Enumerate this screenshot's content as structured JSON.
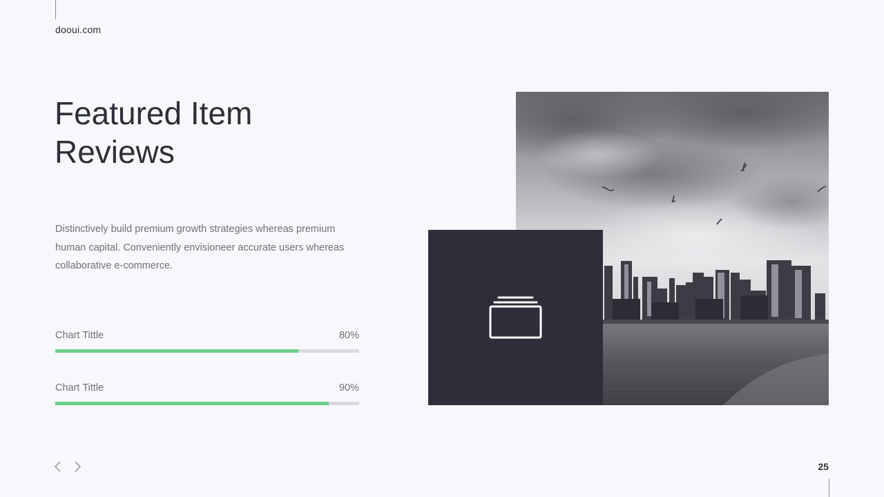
{
  "header": {
    "brand": "dooui.com"
  },
  "main": {
    "title_line1": "Featured Item",
    "title_line2": "Reviews",
    "body": "Distinctively build premium growth strategies whereas premium human capital. Conveniently envisioneer accurate users whereas collaborative e-commerce.",
    "progress": [
      {
        "label": "Chart Tittle",
        "value_text": "80%",
        "value": 0.8
      },
      {
        "label": "Chart Tittle",
        "value_text": "90%",
        "value": 0.9
      }
    ]
  },
  "media": {
    "icon": "stacked-window-icon",
    "photo": "city-skyline-photo"
  },
  "footer": {
    "page_number": "25",
    "prev_icon": "chevron-left-icon",
    "next_icon": "chevron-right-icon"
  },
  "colors": {
    "background": "#f7f8fc",
    "text_dark": "#2e2f3a",
    "text_muted": "#6f7079",
    "accent_green": "#6ccf88",
    "track_gray": "#d9dae0",
    "dark_box": "#2e2e3a"
  }
}
